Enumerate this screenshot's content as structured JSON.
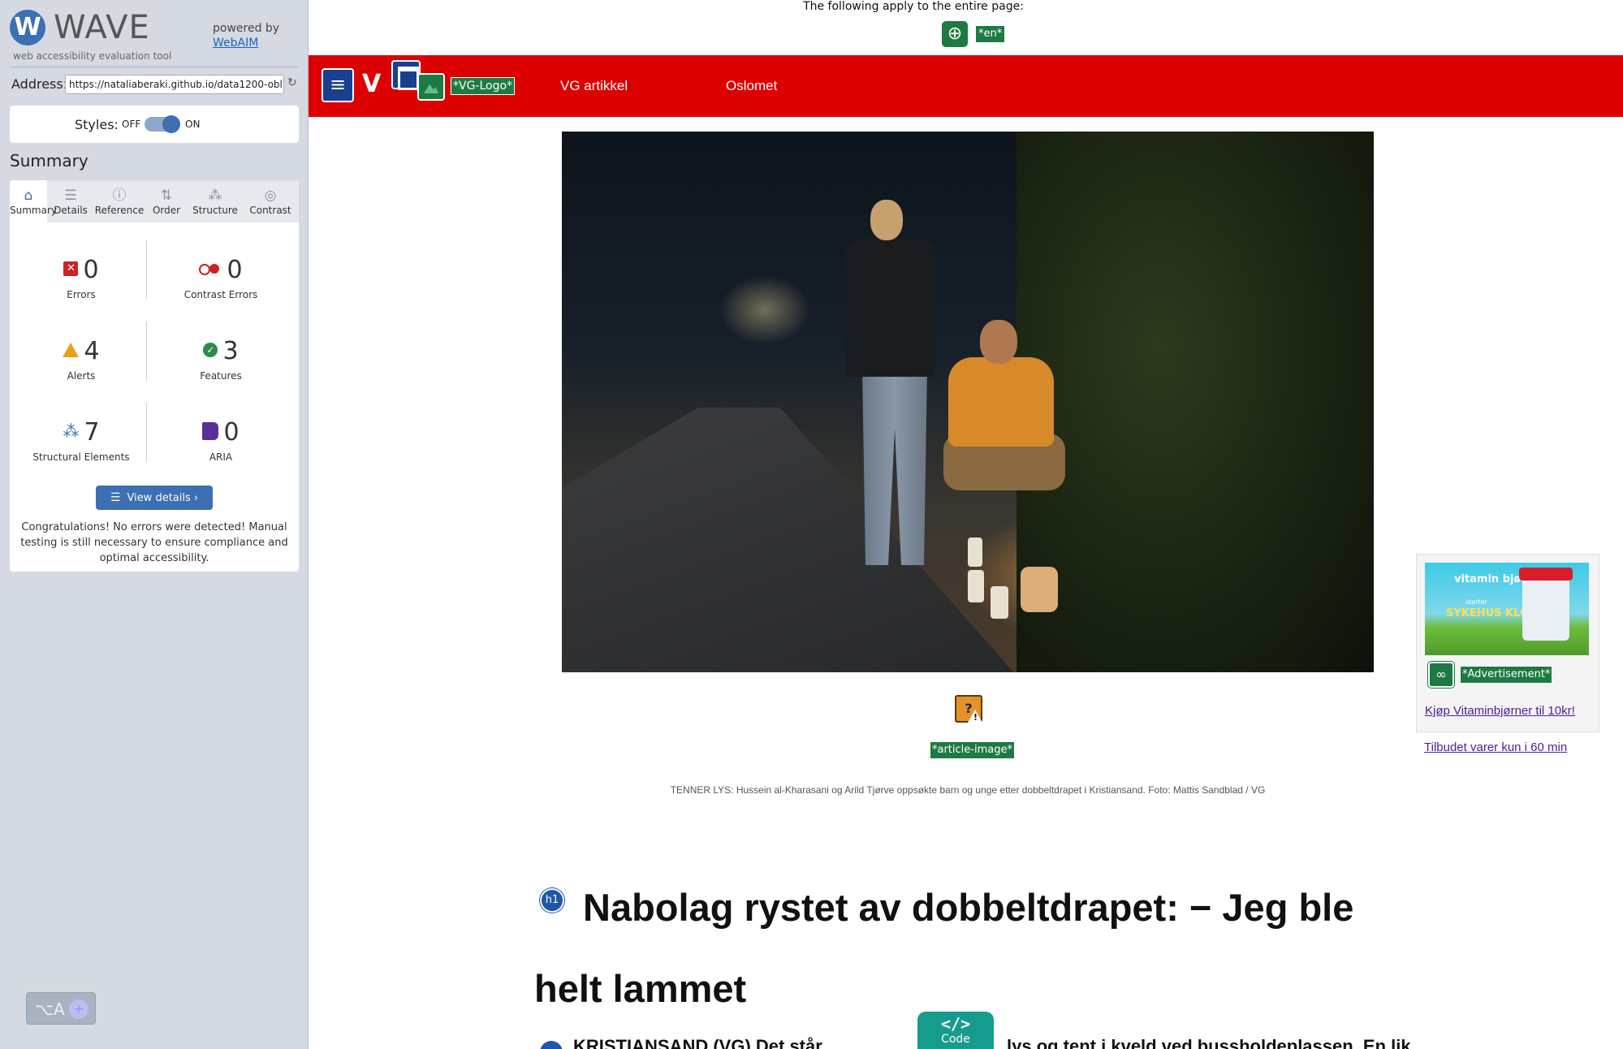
{
  "wave": {
    "logo_letter": "W",
    "logo_word": "WAVE",
    "tagline": "web accessibility evaluation tool",
    "powered_by": "powered by",
    "webaim_link": "WebAIM",
    "address_label": "Address:",
    "address_value": "https://nataliaberaki.github.io/data1200-obl",
    "styles_label": "Styles:",
    "styles_off": "OFF",
    "styles_on": "ON",
    "styles_enabled": true,
    "summary_title": "Summary",
    "tabs": [
      {
        "label": "Summary",
        "icon": "home-icon",
        "active": true
      },
      {
        "label": "Details",
        "icon": "list-icon",
        "active": false
      },
      {
        "label": "Reference",
        "icon": "info-icon",
        "active": false
      },
      {
        "label": "Order",
        "icon": "order-icon",
        "active": false
      },
      {
        "label": "Structure",
        "icon": "structure-icon",
        "active": false
      },
      {
        "label": "Contrast",
        "icon": "contrast-icon",
        "active": false
      }
    ],
    "stats": {
      "errors": {
        "count": "0",
        "label": "Errors"
      },
      "contrast_errors": {
        "count": "0",
        "label": "Contrast Errors"
      },
      "alerts": {
        "count": "4",
        "label": "Alerts"
      },
      "features": {
        "count": "3",
        "label": "Features"
      },
      "structural": {
        "count": "7",
        "label": "Structural Elements"
      },
      "aria": {
        "count": "0",
        "label": "ARIA"
      }
    },
    "view_details": "View details ›",
    "congrats": "Congratulations! No errors were detected! Manual testing is still necessary to ensure compliance and optimal accessibility.",
    "lang_badge": "⌥A"
  },
  "page": {
    "notice": "The following apply to the entire page:",
    "lang_tag": "*en*",
    "vg_letters": "V",
    "vg_logo_tag": "*VG-Logo*",
    "nav": [
      "VG artikkel",
      "Oslomet"
    ],
    "article_image_tag": "*article-image*",
    "caption": "TENNER LYS: Hussein al-Kharasani og Arild Tjørve oppsøkte barn og unge etter dobbeltdrapet i Kristiansand. Foto: Mattis Sandblad / VG",
    "h1_badge": "h1",
    "headline": "Nabolag rystet av dobbeltdrapet: − Jeg ble helt lammet",
    "body_start": "KRISTIANSAND (VG) Det står",
    "body_end": "lys og tent i kveld ved bussholdeplassen. En lik",
    "code_tab_label": "Code",
    "code_tab_icon": "</>",
    "ad": {
      "brand": "vitamin bjørner",
      "brand_sub": "starter",
      "promo": "SYKEHUS KLOVNENE",
      "tag": "*Advertisement*",
      "link": "Kjøp Vitaminbjørner til 10kr!"
    },
    "offer_link": "Tilbudet varer kun i 60 min"
  },
  "colors": {
    "wave_blue": "#3c6fb4",
    "vg_red": "#dd0000",
    "wave_green_tag": "#1e7a43",
    "error_red": "#cc2222",
    "alert_orange": "#e8a21a",
    "aria_purple": "#5a2f9a",
    "code_teal": "#169c8c",
    "visited_link": "#4b1e9a"
  }
}
